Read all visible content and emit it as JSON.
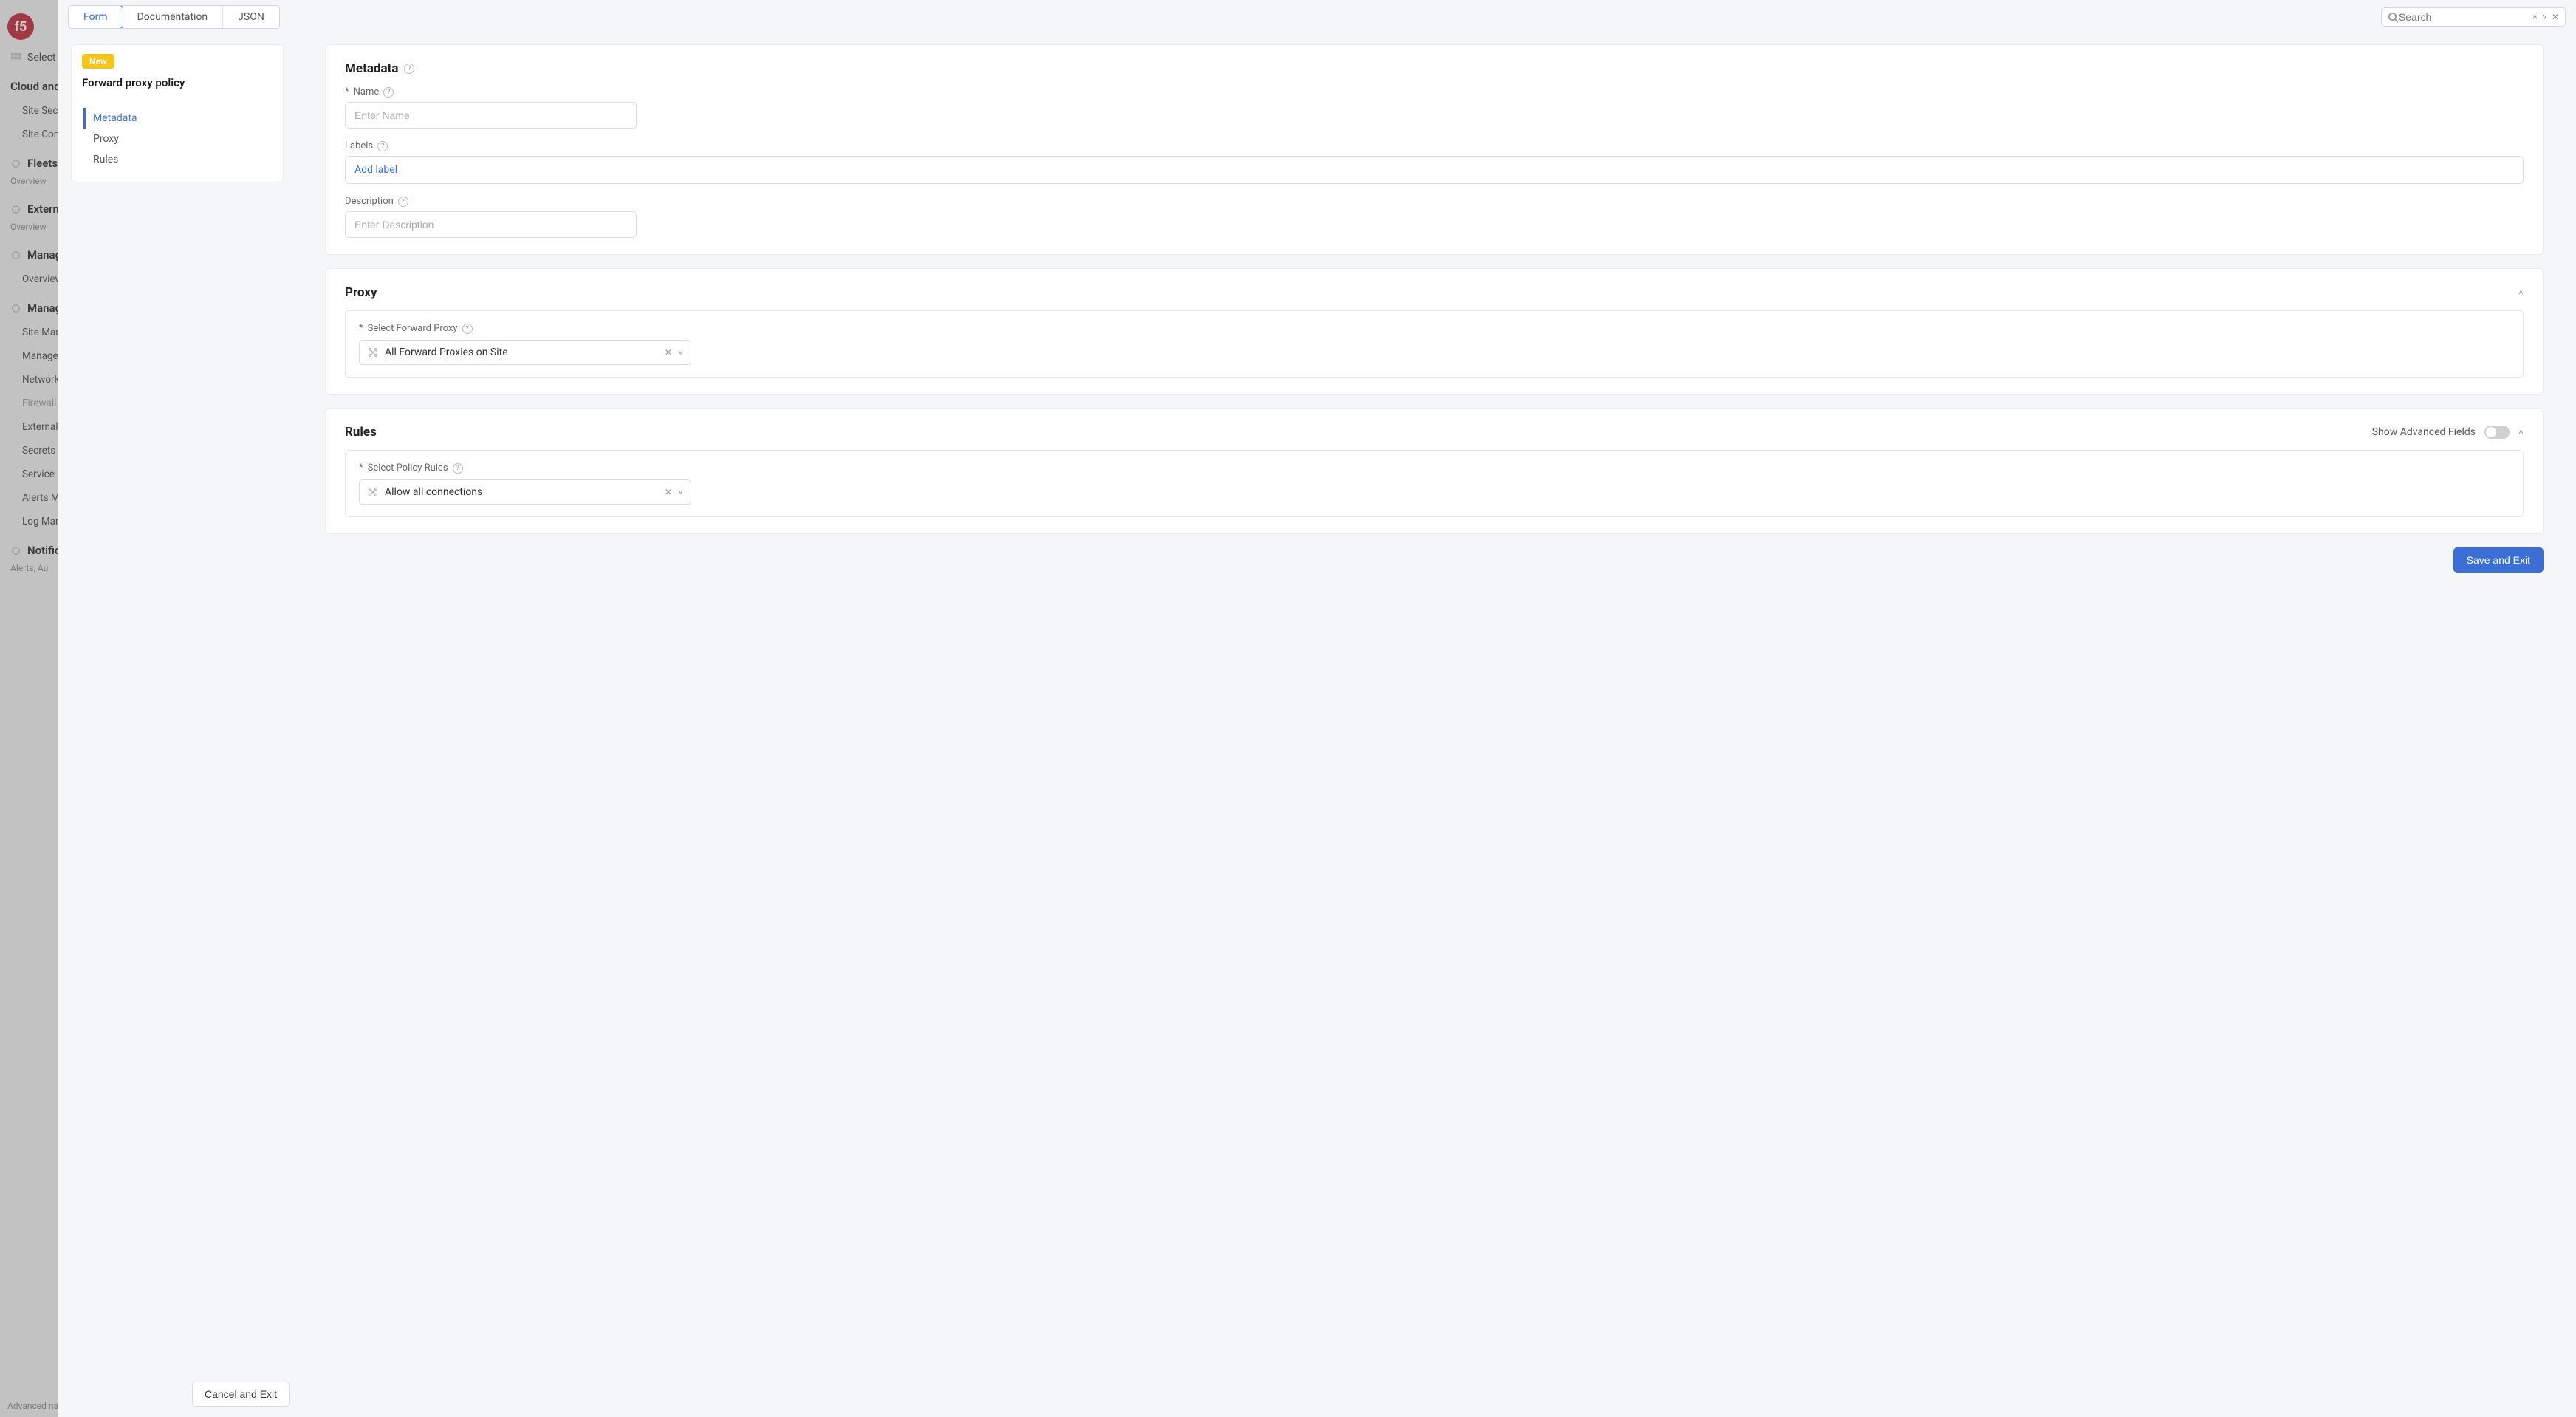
{
  "bg_sidebar": {
    "select_label": "Select s",
    "heading": "Cloud and",
    "items": [
      {
        "type": "leaf",
        "label": "Site Sec"
      },
      {
        "type": "leaf",
        "label": "Site Con"
      },
      {
        "type": "section",
        "label": "Fleets",
        "icon": "fleets"
      },
      {
        "type": "sub",
        "label": "Overview"
      },
      {
        "type": "section",
        "label": "Externa",
        "icon": "external"
      },
      {
        "type": "sub",
        "label": "Overview"
      },
      {
        "type": "section",
        "label": "Manage",
        "icon": "manage"
      },
      {
        "type": "leaf",
        "label": "Overview"
      },
      {
        "type": "section",
        "label": "Manage",
        "icon": "wrench"
      },
      {
        "type": "leaf",
        "label": "Site Man"
      },
      {
        "type": "leaf",
        "label": "Manage"
      },
      {
        "type": "leaf",
        "label": "Network"
      },
      {
        "type": "leaf",
        "label": "Firewall",
        "muted": true
      },
      {
        "type": "leaf",
        "label": "External"
      },
      {
        "type": "leaf",
        "label": "Secrets"
      },
      {
        "type": "leaf",
        "label": "Service"
      },
      {
        "type": "leaf",
        "label": "Alerts M"
      },
      {
        "type": "leaf",
        "label": "Log Man"
      },
      {
        "type": "section",
        "label": "Notifica",
        "icon": "bell"
      },
      {
        "type": "sub",
        "label": "Alerts, Au"
      }
    ],
    "footer": "Advanced nav"
  },
  "tabs": [
    "Form",
    "Documentation",
    "JSON"
  ],
  "tabs_active": 0,
  "search": {
    "placeholder": "Search"
  },
  "left_panel": {
    "badge": "New",
    "title": "Forward proxy policy",
    "nav": [
      "Metadata",
      "Proxy",
      "Rules"
    ],
    "nav_active": 0
  },
  "sections": {
    "metadata": {
      "title": "Metadata",
      "name_label": "Name",
      "name_placeholder": "Enter Name",
      "labels_label": "Labels",
      "labels_placeholder": "Add label",
      "description_label": "Description",
      "description_placeholder": "Enter Description"
    },
    "proxy": {
      "title": "Proxy",
      "select_label": "Select Forward Proxy",
      "select_value": "All Forward Proxies on Site"
    },
    "rules": {
      "title": "Rules",
      "advanced_label": "Show Advanced Fields",
      "select_label": "Select Policy Rules",
      "select_value": "Allow all connections"
    }
  },
  "buttons": {
    "save": "Save and Exit",
    "cancel": "Cancel and Exit"
  }
}
